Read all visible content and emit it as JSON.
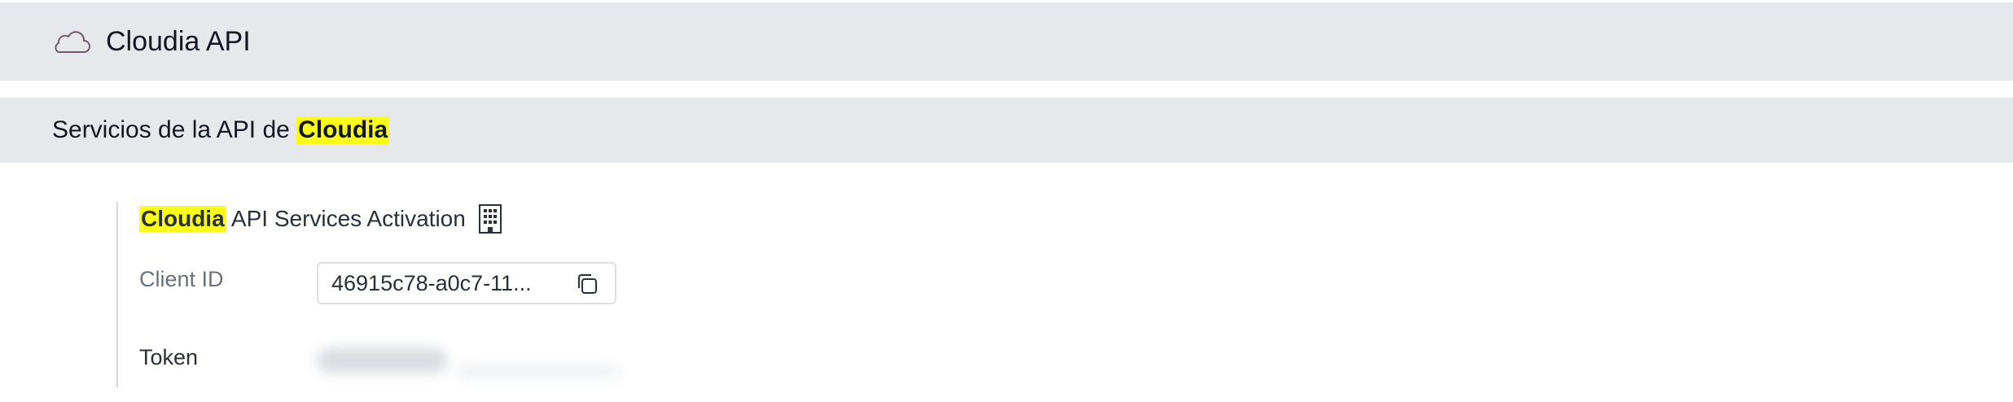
{
  "app": {
    "title": "Cloudia API",
    "icon": "cloud-icon"
  },
  "section": {
    "prefix": "Servicios de la API de ",
    "highlight": "Cloudia"
  },
  "card": {
    "title_highlight": "Cloudia",
    "title_rest": " API Services Activation",
    "title_icon": "building-icon",
    "client_id_label": "Client ID",
    "client_id_value": "46915c78-a0c7-11...",
    "copy_icon": "copy-icon",
    "token_label": "Token"
  },
  "colors": {
    "header_bg": "#e7e8ec",
    "highlight": "#fbff17",
    "text": "#1f2430",
    "muted": "#6b717c"
  }
}
